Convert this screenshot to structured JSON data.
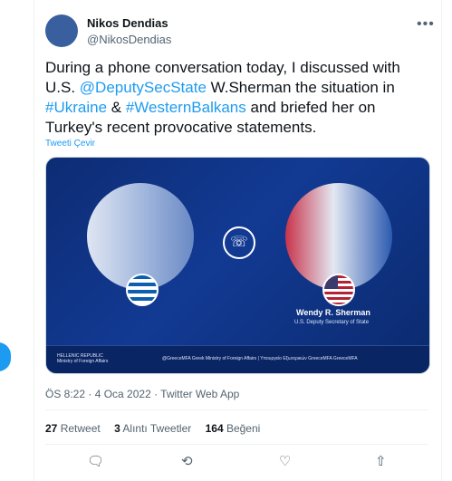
{
  "user": {
    "name": "Nikos Dendias",
    "handle": "@NikosDendias"
  },
  "tweet": {
    "text_1": "During a phone conversation today, I discussed with U.S. ",
    "mention": "@DeputySecState",
    "text_2": " W.Sherman the situation in ",
    "hashtag_1": "#Ukraine",
    "text_3": " & ",
    "hashtag_2": "#WesternBalkans",
    "text_4": " and briefed her on Turkey's recent provocative statements.",
    "translate": "Tweeti Çevir"
  },
  "media": {
    "person_name": "Wendy R. Sherman",
    "person_title": "U.S. Deputy Secretary of State",
    "org_line1": "HELLENIC REPUBLIC",
    "org_line2": "Ministry of Foreign Affairs",
    "footer_links": "@GreeceMFA   Greek Ministry of Foreign Affairs | Υπουργείο Εξωτερικών   GreeceMFA   GreeceMFA"
  },
  "meta": {
    "time": "ÖS 8:22 · 4 Oca 2022 · Twitter Web App"
  },
  "stats": {
    "retweets_count": "27",
    "retweets_label": " Retweet",
    "quotes_count": "3",
    "quotes_label": " Alıntı Tweetler",
    "likes_count": "164",
    "likes_label": " Beğeni"
  },
  "colors": {
    "accent": "#1d9bf0",
    "text": "#0f1419",
    "secondary": "#536471"
  }
}
